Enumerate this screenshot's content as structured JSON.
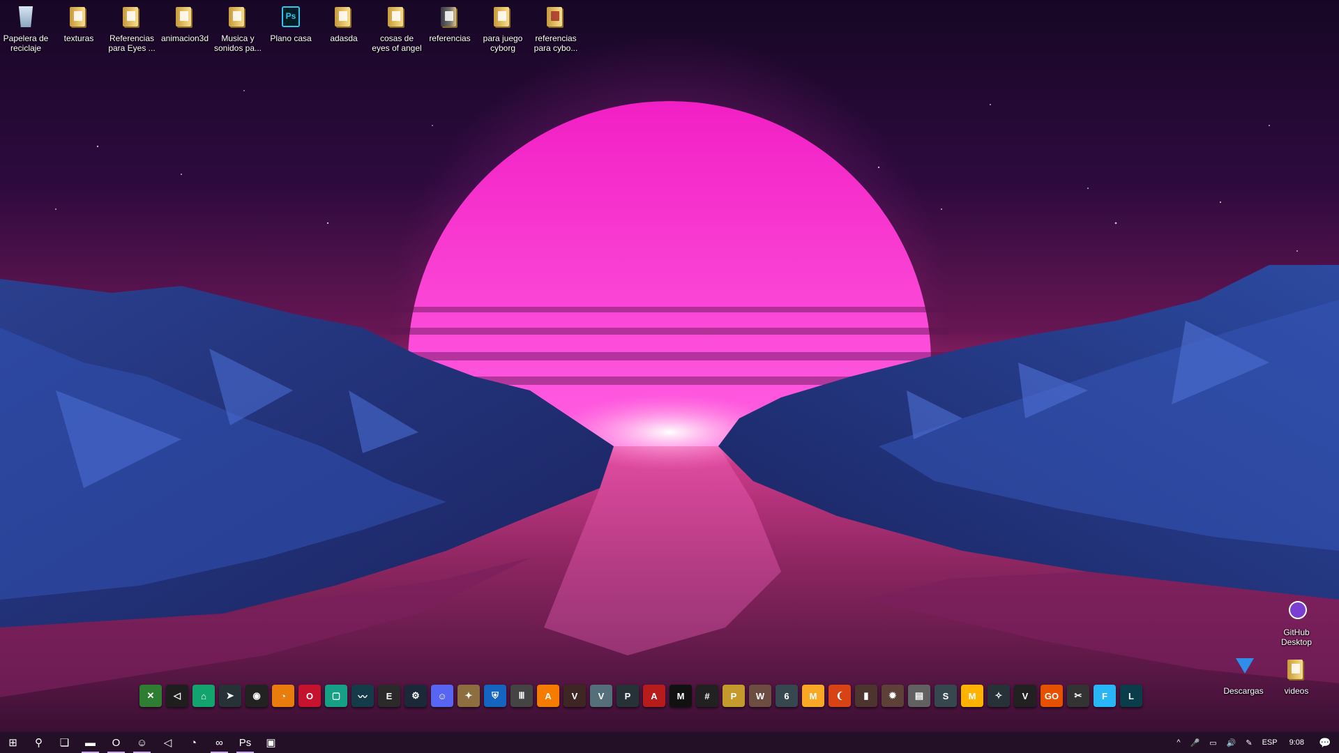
{
  "desktop": {
    "icons": [
      {
        "id": "recycle",
        "label": "Papelera de reciclaje",
        "icon": "recycle-bin-icon"
      },
      {
        "id": "texturas",
        "label": "texturas",
        "icon": "folder-icon"
      },
      {
        "id": "refs-eyes",
        "label": "Referencias para Eyes ...",
        "icon": "folder-icon"
      },
      {
        "id": "animacion3d",
        "label": "animacion3d",
        "icon": "folder-icon"
      },
      {
        "id": "musica",
        "label": "Musica y sonidos pa...",
        "icon": "folder-icon"
      },
      {
        "id": "plano",
        "label": "Plano casa",
        "icon": "photoshop-file-icon"
      },
      {
        "id": "adasda",
        "label": "adasda",
        "icon": "folder-icon"
      },
      {
        "id": "cosas",
        "label": "cosas de eyes of angel",
        "icon": "folder-icon"
      },
      {
        "id": "referencias",
        "label": "referencias",
        "icon": "folder-icon"
      },
      {
        "id": "juego",
        "label": "para juego cyborg",
        "icon": "folder-icon"
      },
      {
        "id": "refs-cybo",
        "label": "referencias para cybo...",
        "icon": "folder-icon"
      }
    ],
    "right_icons": [
      {
        "id": "github",
        "label": "GitHub Desktop",
        "icon": "github-desktop-icon"
      },
      {
        "id": "descargas",
        "label": "Descargas",
        "icon": "downloads-icon"
      },
      {
        "id": "videos",
        "label": "videos",
        "icon": "folder-icon"
      }
    ],
    "ps_badge": "Ps"
  },
  "dock": {
    "items": [
      {
        "name": "xbox-icon",
        "glyph": "✕",
        "color": "#2e7d32"
      },
      {
        "name": "unity-icon",
        "glyph": "◁",
        "color": "#1e1e1e"
      },
      {
        "name": "app-green-icon",
        "glyph": "⌂",
        "color": "#12a36f"
      },
      {
        "name": "app-arrow-icon",
        "glyph": "➤",
        "color": "#263238"
      },
      {
        "name": "obs-icon",
        "glyph": "◉",
        "color": "#222"
      },
      {
        "name": "blender-icon",
        "glyph": "◔",
        "color": "#e87d0d"
      },
      {
        "name": "opera-icon",
        "glyph": "O",
        "color": "#c4122f"
      },
      {
        "name": "app-teal-icon",
        "glyph": "▢",
        "color": "#16a085"
      },
      {
        "name": "waveform-icon",
        "glyph": "〰",
        "color": "#143b47"
      },
      {
        "name": "epic-games-icon",
        "glyph": "E",
        "color": "#2a2a2a"
      },
      {
        "name": "steam-icon",
        "glyph": "⚙",
        "color": "#1b2838"
      },
      {
        "name": "discord-icon",
        "glyph": "☺",
        "color": "#5865f2"
      },
      {
        "name": "game-1-icon",
        "glyph": "✦",
        "color": "#8d6e3f"
      },
      {
        "name": "rocket-league-icon",
        "glyph": "⛨",
        "color": "#1565c0"
      },
      {
        "name": "dead-by-daylight-icon",
        "glyph": "Ⅲ",
        "color": "#444"
      },
      {
        "name": "apex-icon",
        "glyph": "A",
        "color": "#f57c00"
      },
      {
        "name": "vampire-icon",
        "glyph": "V",
        "color": "#3e2723"
      },
      {
        "name": "gta-icon",
        "glyph": "V",
        "color": "#546e7a"
      },
      {
        "name": "paladins-icon",
        "glyph": "P",
        "color": "#263238"
      },
      {
        "name": "albion-icon",
        "glyph": "A",
        "color": "#b71c1c"
      },
      {
        "name": "mw-icon",
        "glyph": "M",
        "color": "#111"
      },
      {
        "name": "game-hash-icon",
        "glyph": "#",
        "color": "#212121"
      },
      {
        "name": "pubg-icon",
        "glyph": "P",
        "color": "#c49a2c"
      },
      {
        "name": "wow-icon",
        "glyph": "W",
        "color": "#6d4c41"
      },
      {
        "name": "rainbow-six-icon",
        "glyph": "6",
        "color": "#37474f"
      },
      {
        "name": "metro-icon",
        "glyph": "M",
        "color": "#f9a825"
      },
      {
        "name": "game-2-icon",
        "glyph": "❨",
        "color": "#d84315"
      },
      {
        "name": "game-3-icon",
        "glyph": "▮",
        "color": "#4e342e"
      },
      {
        "name": "game-4-icon",
        "glyph": "✹",
        "color": "#5d4037"
      },
      {
        "name": "game-5-icon",
        "glyph": "▤",
        "color": "#616161"
      },
      {
        "name": "smite-icon",
        "glyph": "S",
        "color": "#37474f"
      },
      {
        "name": "game-m-icon",
        "glyph": "M",
        "color": "#ffb300"
      },
      {
        "name": "game-6-icon",
        "glyph": "✧",
        "color": "#263238"
      },
      {
        "name": "valorant-icon",
        "glyph": "V",
        "color": "#212121"
      },
      {
        "name": "csgo-icon",
        "glyph": "GO",
        "color": "#e65100"
      },
      {
        "name": "game-7-icon",
        "glyph": "✂",
        "color": "#333"
      },
      {
        "name": "fortnite-icon",
        "glyph": "F",
        "color": "#29b6f6"
      },
      {
        "name": "league-icon",
        "glyph": "L",
        "color": "#0a3c4a"
      }
    ]
  },
  "taskbar": {
    "apps": [
      {
        "name": "start-button",
        "glyph": "⊞",
        "pinned": false
      },
      {
        "name": "search-icon",
        "glyph": "⚲",
        "pinned": false
      },
      {
        "name": "task-view-icon",
        "glyph": "❏",
        "pinned": false
      },
      {
        "name": "file-explorer-icon",
        "glyph": "▬",
        "pinned": true
      },
      {
        "name": "opera-taskbar-icon",
        "glyph": "O",
        "pinned": true
      },
      {
        "name": "discord-taskbar-icon",
        "glyph": "☺",
        "pinned": true
      },
      {
        "name": "unity-taskbar-icon",
        "glyph": "◁",
        "pinned": false
      },
      {
        "name": "github-taskbar-icon",
        "glyph": "◔",
        "pinned": false
      },
      {
        "name": "visual-studio-taskbar-icon",
        "glyph": "∞",
        "pinned": true
      },
      {
        "name": "photoshop-taskbar-icon",
        "glyph": "Ps",
        "pinned": true
      },
      {
        "name": "app-taskbar-icon",
        "glyph": "▣",
        "pinned": false
      }
    ],
    "tray": {
      "chevron": "^",
      "mic": "🎤",
      "network": "▭",
      "volume": "🔊",
      "pen": "✎",
      "language": "ESP",
      "time": "9:08",
      "notifications": "💬"
    }
  }
}
